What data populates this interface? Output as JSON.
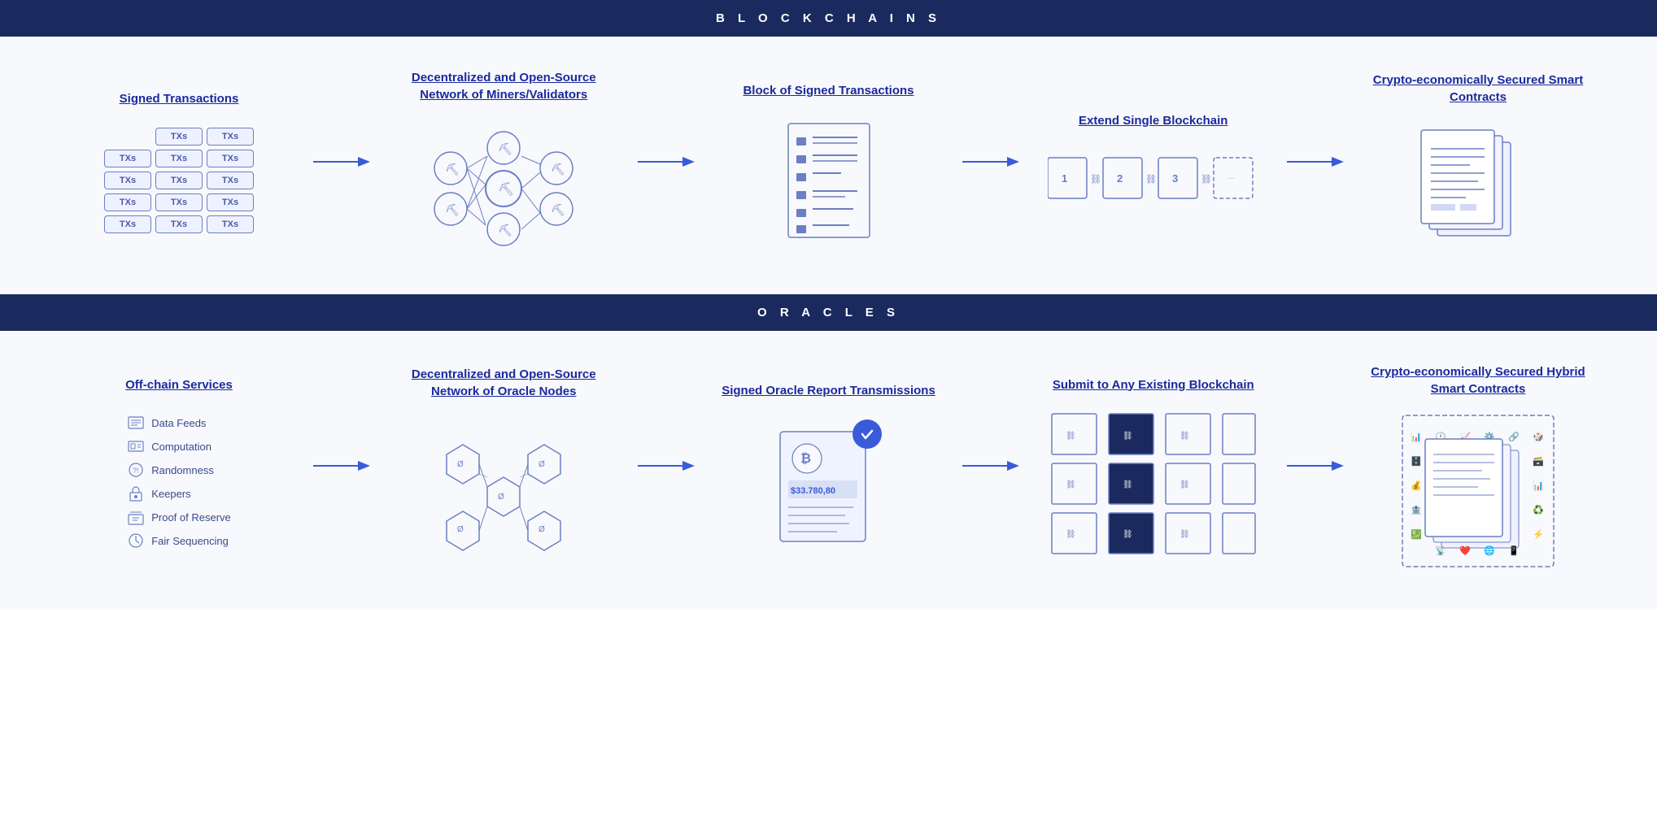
{
  "blockchains": {
    "header": "B L O C K C H A I N S",
    "steps": [
      {
        "title": "Signed Transactions",
        "id": "signed-transactions"
      },
      {
        "title": "Decentralized and Open-Source Network of Miners/Validators",
        "id": "miners-validators"
      },
      {
        "title": "Block of Signed Transactions",
        "id": "block-signed"
      },
      {
        "title": "Extend Single Blockchain",
        "id": "extend-blockchain"
      },
      {
        "title": "Crypto-economically Secured Smart Contracts",
        "id": "smart-contracts"
      }
    ]
  },
  "oracles": {
    "header": "O R A C L E S",
    "steps": [
      {
        "title": "Off-chain Services",
        "id": "offchain-services"
      },
      {
        "title": "Decentralized and Open-Source Network of Oracle Nodes",
        "id": "oracle-nodes"
      },
      {
        "title": "Signed Oracle Report Transmissions",
        "id": "oracle-reports"
      },
      {
        "title": "Submit to Any Existing Blockchain",
        "id": "submit-blockchain"
      },
      {
        "title": "Crypto-economically Secured Hybrid Smart Contracts",
        "id": "hybrid-contracts"
      }
    ],
    "offchainItems": [
      {
        "label": "Data Feeds",
        "icon": "data-feeds"
      },
      {
        "label": "Computation",
        "icon": "computation"
      },
      {
        "label": "Randomness",
        "icon": "randomness"
      },
      {
        "label": "Keepers",
        "icon": "keepers"
      },
      {
        "label": "Proof of Reserve",
        "icon": "proof-reserve"
      },
      {
        "label": "Fair Sequencing",
        "icon": "fair-sequencing"
      }
    ],
    "oraclePrice": "$33.780,80"
  },
  "colors": {
    "primary": "#1a2a5e",
    "accent": "#3a5bd9",
    "lightBlue": "#6b7fc4",
    "boxBg": "#eef1ff",
    "arrow": "#3a5bd9"
  }
}
